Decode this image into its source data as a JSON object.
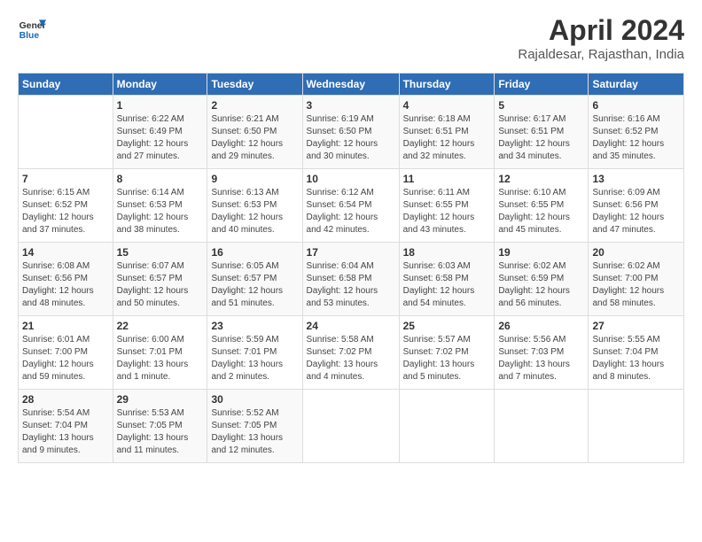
{
  "header": {
    "logo_line1": "General",
    "logo_line2": "Blue",
    "month": "April 2024",
    "location": "Rajaldesar, Rajasthan, India"
  },
  "weekdays": [
    "Sunday",
    "Monday",
    "Tuesday",
    "Wednesday",
    "Thursday",
    "Friday",
    "Saturday"
  ],
  "weeks": [
    [
      {
        "day": "",
        "info": ""
      },
      {
        "day": "1",
        "info": "Sunrise: 6:22 AM\nSunset: 6:49 PM\nDaylight: 12 hours\nand 27 minutes."
      },
      {
        "day": "2",
        "info": "Sunrise: 6:21 AM\nSunset: 6:50 PM\nDaylight: 12 hours\nand 29 minutes."
      },
      {
        "day": "3",
        "info": "Sunrise: 6:19 AM\nSunset: 6:50 PM\nDaylight: 12 hours\nand 30 minutes."
      },
      {
        "day": "4",
        "info": "Sunrise: 6:18 AM\nSunset: 6:51 PM\nDaylight: 12 hours\nand 32 minutes."
      },
      {
        "day": "5",
        "info": "Sunrise: 6:17 AM\nSunset: 6:51 PM\nDaylight: 12 hours\nand 34 minutes."
      },
      {
        "day": "6",
        "info": "Sunrise: 6:16 AM\nSunset: 6:52 PM\nDaylight: 12 hours\nand 35 minutes."
      }
    ],
    [
      {
        "day": "7",
        "info": "Sunrise: 6:15 AM\nSunset: 6:52 PM\nDaylight: 12 hours\nand 37 minutes."
      },
      {
        "day": "8",
        "info": "Sunrise: 6:14 AM\nSunset: 6:53 PM\nDaylight: 12 hours\nand 38 minutes."
      },
      {
        "day": "9",
        "info": "Sunrise: 6:13 AM\nSunset: 6:53 PM\nDaylight: 12 hours\nand 40 minutes."
      },
      {
        "day": "10",
        "info": "Sunrise: 6:12 AM\nSunset: 6:54 PM\nDaylight: 12 hours\nand 42 minutes."
      },
      {
        "day": "11",
        "info": "Sunrise: 6:11 AM\nSunset: 6:55 PM\nDaylight: 12 hours\nand 43 minutes."
      },
      {
        "day": "12",
        "info": "Sunrise: 6:10 AM\nSunset: 6:55 PM\nDaylight: 12 hours\nand 45 minutes."
      },
      {
        "day": "13",
        "info": "Sunrise: 6:09 AM\nSunset: 6:56 PM\nDaylight: 12 hours\nand 47 minutes."
      }
    ],
    [
      {
        "day": "14",
        "info": "Sunrise: 6:08 AM\nSunset: 6:56 PM\nDaylight: 12 hours\nand 48 minutes."
      },
      {
        "day": "15",
        "info": "Sunrise: 6:07 AM\nSunset: 6:57 PM\nDaylight: 12 hours\nand 50 minutes."
      },
      {
        "day": "16",
        "info": "Sunrise: 6:05 AM\nSunset: 6:57 PM\nDaylight: 12 hours\nand 51 minutes."
      },
      {
        "day": "17",
        "info": "Sunrise: 6:04 AM\nSunset: 6:58 PM\nDaylight: 12 hours\nand 53 minutes."
      },
      {
        "day": "18",
        "info": "Sunrise: 6:03 AM\nSunset: 6:58 PM\nDaylight: 12 hours\nand 54 minutes."
      },
      {
        "day": "19",
        "info": "Sunrise: 6:02 AM\nSunset: 6:59 PM\nDaylight: 12 hours\nand 56 minutes."
      },
      {
        "day": "20",
        "info": "Sunrise: 6:02 AM\nSunset: 7:00 PM\nDaylight: 12 hours\nand 58 minutes."
      }
    ],
    [
      {
        "day": "21",
        "info": "Sunrise: 6:01 AM\nSunset: 7:00 PM\nDaylight: 12 hours\nand 59 minutes."
      },
      {
        "day": "22",
        "info": "Sunrise: 6:00 AM\nSunset: 7:01 PM\nDaylight: 13 hours\nand 1 minute."
      },
      {
        "day": "23",
        "info": "Sunrise: 5:59 AM\nSunset: 7:01 PM\nDaylight: 13 hours\nand 2 minutes."
      },
      {
        "day": "24",
        "info": "Sunrise: 5:58 AM\nSunset: 7:02 PM\nDaylight: 13 hours\nand 4 minutes."
      },
      {
        "day": "25",
        "info": "Sunrise: 5:57 AM\nSunset: 7:02 PM\nDaylight: 13 hours\nand 5 minutes."
      },
      {
        "day": "26",
        "info": "Sunrise: 5:56 AM\nSunset: 7:03 PM\nDaylight: 13 hours\nand 7 minutes."
      },
      {
        "day": "27",
        "info": "Sunrise: 5:55 AM\nSunset: 7:04 PM\nDaylight: 13 hours\nand 8 minutes."
      }
    ],
    [
      {
        "day": "28",
        "info": "Sunrise: 5:54 AM\nSunset: 7:04 PM\nDaylight: 13 hours\nand 9 minutes."
      },
      {
        "day": "29",
        "info": "Sunrise: 5:53 AM\nSunset: 7:05 PM\nDaylight: 13 hours\nand 11 minutes."
      },
      {
        "day": "30",
        "info": "Sunrise: 5:52 AM\nSunset: 7:05 PM\nDaylight: 13 hours\nand 12 minutes."
      },
      {
        "day": "",
        "info": ""
      },
      {
        "day": "",
        "info": ""
      },
      {
        "day": "",
        "info": ""
      },
      {
        "day": "",
        "info": ""
      }
    ]
  ]
}
